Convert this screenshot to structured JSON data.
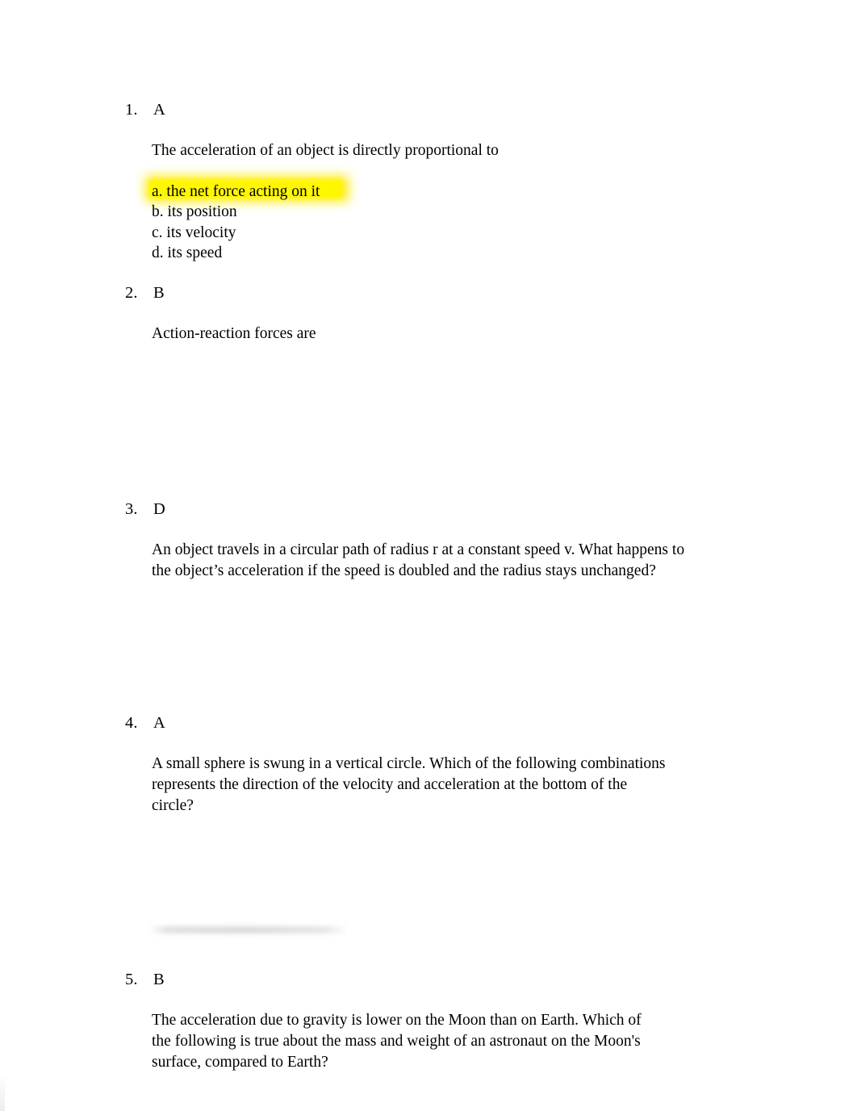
{
  "document": {
    "background_color": "#ffffff",
    "text_color": "#000000",
    "highlight_color": "#fff700"
  },
  "questions": [
    {
      "number": "1.",
      "answer": "A",
      "prompt": "The acceleration of an object is directly proportional to",
      "options": [
        {
          "label": "a. the net force acting on it",
          "highlighted": true
        },
        {
          "label": "b. its position",
          "highlighted": false
        },
        {
          "label": "c. its velocity",
          "highlighted": false
        },
        {
          "label": "d. its speed",
          "highlighted": false
        }
      ]
    },
    {
      "number": "2.",
      "answer": "B",
      "prompt": "Action-reaction forces are",
      "options": []
    },
    {
      "number": "3.",
      "answer": "D",
      "prompt": "An object travels in a circular path of radius r at a constant speed v. What happens to the object’s acceleration if the speed is doubled and the radius stays unchanged?",
      "options": []
    },
    {
      "number": "4.",
      "answer": "A",
      "prompt": "A small sphere is swung in a vertical circle. Which of the following combinations represents the direction of the velocity and acceleration at the bottom of the circle?",
      "options": []
    },
    {
      "number": "5.",
      "answer": "B",
      "prompt": "The acceleration due to gravity is lower on the Moon than on Earth. Which of the following is true about the mass and weight of an astronaut on the Moon's surface, compared to Earth?",
      "options": []
    }
  ]
}
